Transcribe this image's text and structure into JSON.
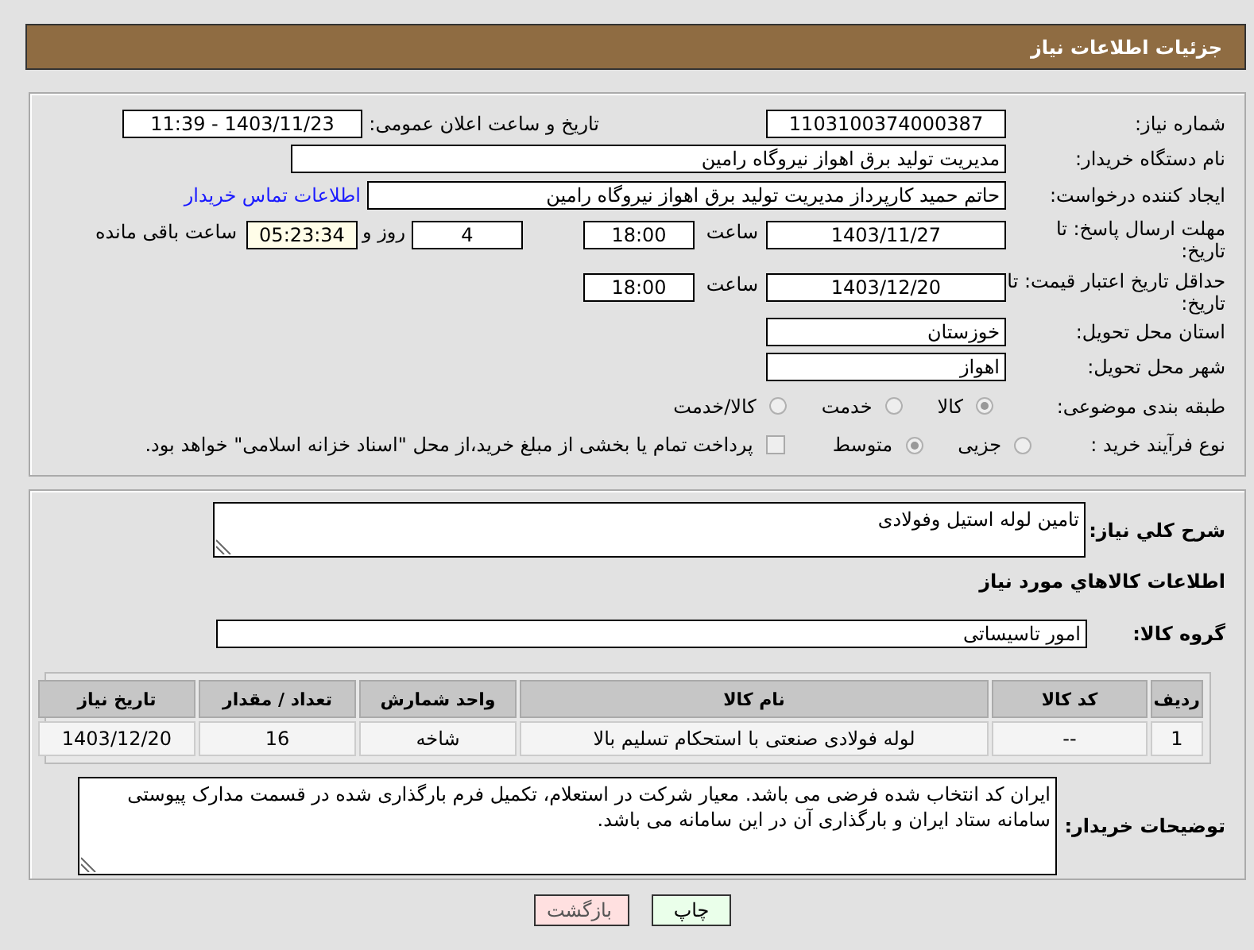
{
  "header": {
    "title": "جزئیات اطلاعات نیاز"
  },
  "general": {
    "need_number": {
      "label": "شماره نیاز:",
      "value": "1103100374000387"
    },
    "announce": {
      "label": "تاریخ و ساعت اعلان عمومی:",
      "value": "1403/11/23 - 11:39"
    },
    "buyer_org": {
      "label": "نام دستگاه خریدار:",
      "value": "مدیریت تولید برق اهواز نیروگاه رامین"
    },
    "requester": {
      "label": "ایجاد کننده درخواست:",
      "value": "حاتم حمید کارپرداز مدیریت تولید برق اهواز نیروگاه رامین",
      "link": "اطلاعات تماس خریدار"
    },
    "reply_deadline": {
      "label": "مهلت ارسال پاسخ: تا تاریخ:",
      "date": "1403/11/27",
      "time_label": "ساعت",
      "time": "18:00",
      "days": "4",
      "days_label": "روز و",
      "remaining": "05:23:34",
      "remaining_label": "ساعت باقی مانده"
    },
    "price_validity": {
      "label": "حداقل تاریخ اعتبار قیمت: تا تاریخ:",
      "date": "1403/12/20",
      "time_label": "ساعت",
      "time": "18:00"
    },
    "province": {
      "label": "استان محل تحویل:",
      "value": "خوزستان"
    },
    "city": {
      "label": "شهر محل تحویل:",
      "value": "اهواز"
    },
    "category": {
      "label": "طبقه بندی موضوعی:",
      "options": [
        {
          "label": "کالا",
          "selected": true
        },
        {
          "label": "خدمت",
          "selected": false
        },
        {
          "label": "کالا/خدمت",
          "selected": false
        }
      ]
    },
    "process": {
      "label": "نوع فرآیند خرید :",
      "options": [
        {
          "kind": "radio",
          "label": "جزیی",
          "selected": false
        },
        {
          "kind": "radio",
          "label": "متوسط",
          "selected": true
        },
        {
          "kind": "checkbox",
          "label": "پرداخت تمام یا بخشی از مبلغ خرید،از محل \"اسناد خزانه اسلامی\" خواهد بود.",
          "checked": false
        }
      ]
    }
  },
  "details": {
    "description": {
      "label": "شرح کلي نياز:",
      "value": "تامین لوله استیل وفولادی"
    },
    "items_heading": "اطلاعات کالاهاي مورد نياز",
    "goods_group": {
      "label": "گروه کالا:",
      "value": "امور تاسیساتی"
    },
    "table": {
      "columns": [
        "ردیف",
        "کد کالا",
        "نام کالا",
        "واحد شمارش",
        "تعداد / مقدار",
        "تاریخ نیاز"
      ],
      "rows": [
        [
          "1",
          "--",
          "لوله فولادی صنعتی با استحکام تسلیم بالا",
          "شاخه",
          "16",
          "1403/12/20"
        ]
      ]
    },
    "buyer_notes": {
      "label": "توضیحات خریدار:",
      "value": "ایران کد انتخاب شده فرضی می باشد. معیار شرکت در استعلام، تکمیل فرم بارگذاری شده در قسمت مدارک پیوستی سامانه ستاد ایران و بارگذاری آن در این سامانه می باشد."
    }
  },
  "buttons": [
    {
      "kind": "print",
      "label": "چاپ"
    },
    {
      "kind": "back",
      "label": "بازگشت"
    }
  ]
}
